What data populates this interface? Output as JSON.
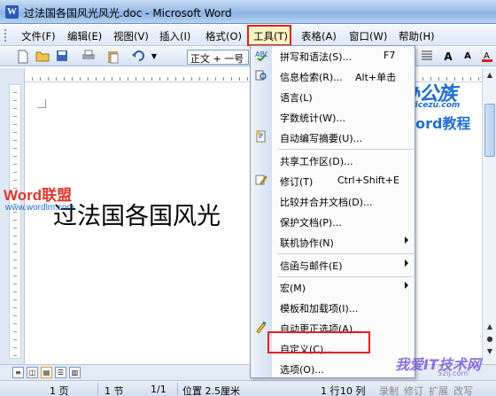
{
  "window": {
    "title": "过法国各国风光风光.doc - Microsoft Word",
    "app_icon": "W"
  },
  "menubar": {
    "items": [
      "文件(F)",
      "编辑(E)",
      "视图(V)",
      "插入(I)",
      "格式(O)",
      "工具(T)",
      "表格(A)",
      "窗口(W)",
      "帮助(H)"
    ]
  },
  "toolbar": {
    "style_value": "正文 + 一号"
  },
  "document": {
    "text": "过法国各国风光"
  },
  "tools_menu": {
    "items": [
      {
        "label": "拼写和语法(S)...",
        "shortcut": "F7",
        "icon": "spelling-icon"
      },
      {
        "label": "信息检索(R)...",
        "shortcut": "Alt+单击",
        "icon": "research-icon"
      },
      {
        "label": "语言(L)",
        "shortcut": "",
        "icon": ""
      },
      {
        "label": "字数统计(W)...",
        "shortcut": "",
        "icon": ""
      },
      {
        "label": "自动编写摘要(U)...",
        "shortcut": "",
        "icon": "autosummary-icon"
      },
      {
        "label": "共享工作区(D)...",
        "shortcut": "",
        "icon": ""
      },
      {
        "label": "修订(T)",
        "shortcut": "Ctrl+Shift+E",
        "icon": "track-changes-icon"
      },
      {
        "label": "比较并合并文档(D)...",
        "shortcut": "",
        "icon": ""
      },
      {
        "label": "保护文档(P)...",
        "shortcut": "",
        "icon": ""
      },
      {
        "label": "联机协作(N)",
        "shortcut": "",
        "icon": ""
      },
      {
        "label": "信函与邮件(E)",
        "shortcut": "",
        "icon": ""
      },
      {
        "label": "宏(M)",
        "shortcut": "",
        "icon": ""
      },
      {
        "label": "模板和加载项(I)...",
        "shortcut": "",
        "icon": ""
      },
      {
        "label": "自动更正选项(A)...",
        "shortcut": "",
        "icon": "autocorrect-icon"
      },
      {
        "label": "自定义(C)...",
        "shortcut": "",
        "icon": ""
      },
      {
        "label": "选项(O)...",
        "shortcut": "",
        "icon": ""
      }
    ]
  },
  "statusbar": {
    "page": "1 页",
    "section": "1 节",
    "page_of": "1/1",
    "position": "位置 2.5厘米",
    "line": "1 行",
    "column": "10 列",
    "rec": "录制",
    "trk": "修订",
    "ext": "扩展",
    "ovr": "改写"
  },
  "watermarks": {
    "bangongzu": {
      "big": "办公族",
      "url": "Officezu.com",
      "sub": "Word教程"
    },
    "wordlm": {
      "big": "Word联盟",
      "url": "www.wordlm.com"
    },
    "bottom": {
      "big": "我爱IT技术网",
      "url": "52ij.com"
    }
  },
  "colors": {
    "highlight_box": "#e01f1f",
    "menubar_bg": "#dde7f5",
    "brand_blue": "#1f6fd0"
  }
}
